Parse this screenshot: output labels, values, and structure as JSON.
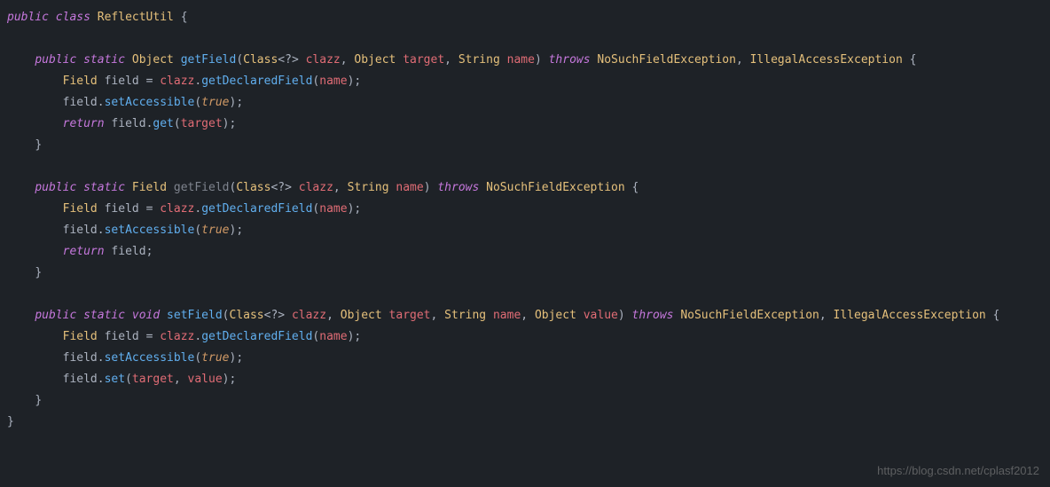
{
  "code": {
    "line1_public": "public",
    "line1_class": "class",
    "line1_classname": "ReflectUtil",
    "line1_brace": "{",
    "m1_public": "public",
    "m1_static": "static",
    "m1_rettype": "Object",
    "m1_name": "getField",
    "m1_paren_open": "(",
    "m1_type_class": "Class",
    "m1_generic": "<?>",
    "m1_param_clazz": "clazz",
    "m1_comma1": ",",
    "m1_type_object": "Object",
    "m1_param_target": "target",
    "m1_comma2": ",",
    "m1_type_string": "String",
    "m1_param_name": "name",
    "m1_paren_close": ")",
    "m1_throws": "throws",
    "m1_exc1": "NoSuchFieldException",
    "m1_comma3": ",",
    "m1_exc2": "IllegalAccessException",
    "m1_brace": "{",
    "m1b1_type": "Field",
    "m1b1_var": "field",
    "m1b1_eq": "=",
    "m1b1_clazz": "clazz",
    "m1b1_dot": ".",
    "m1b1_method": "getDeclaredField",
    "m1b1_paren_open": "(",
    "m1b1_arg": "name",
    "m1b1_paren_close": ")",
    "m1b1_semi": ";",
    "m1b2_var": "field",
    "m1b2_dot": ".",
    "m1b2_method": "setAccessible",
    "m1b2_paren_open": "(",
    "m1b2_true": "true",
    "m1b2_paren_close": ")",
    "m1b2_semi": ";",
    "m1b3_return": "return",
    "m1b3_var": "field",
    "m1b3_dot": ".",
    "m1b3_method": "get",
    "m1b3_paren_open": "(",
    "m1b3_arg": "target",
    "m1b3_paren_close": ")",
    "m1b3_semi": ";",
    "m1_close": "}",
    "m2_public": "public",
    "m2_static": "static",
    "m2_rettype": "Field",
    "m2_name": "getField",
    "m2_paren_open": "(",
    "m2_type_class": "Class",
    "m2_generic": "<?>",
    "m2_param_clazz": "clazz",
    "m2_comma1": ",",
    "m2_type_string": "String",
    "m2_param_name": "name",
    "m2_paren_close": ")",
    "m2_throws": "throws",
    "m2_exc1": "NoSuchFieldException",
    "m2_brace": "{",
    "m2b1_type": "Field",
    "m2b1_var": "field",
    "m2b1_eq": "=",
    "m2b1_clazz": "clazz",
    "m2b1_dot": ".",
    "m2b1_method": "getDeclaredField",
    "m2b1_paren_open": "(",
    "m2b1_arg": "name",
    "m2b1_paren_close": ")",
    "m2b1_semi": ";",
    "m2b2_var": "field",
    "m2b2_dot": ".",
    "m2b2_method": "setAccessible",
    "m2b2_paren_open": "(",
    "m2b2_true": "true",
    "m2b2_paren_close": ")",
    "m2b2_semi": ";",
    "m2b3_return": "return",
    "m2b3_var": "field",
    "m2b3_semi": ";",
    "m2_close": "}",
    "m3_public": "public",
    "m3_static": "static",
    "m3_rettype": "void",
    "m3_name": "setField",
    "m3_paren_open": "(",
    "m3_type_class": "Class",
    "m3_generic": "<?>",
    "m3_param_clazz": "clazz",
    "m3_comma1": ",",
    "m3_type_object": "Object",
    "m3_param_target": "target",
    "m3_comma2": ",",
    "m3_type_string": "String",
    "m3_param_name": "name",
    "m3_comma3": ",",
    "m3_type_object2": "Object",
    "m3_param_value": "value",
    "m3_paren_close": ")",
    "m3_throws": "throws",
    "m3_exc1": "NoSuchFieldException",
    "m3_comma4": ",",
    "m3_exc2": "IllegalAccessException",
    "m3_brace": "{",
    "m3b1_type": "Field",
    "m3b1_var": "field",
    "m3b1_eq": "=",
    "m3b1_clazz": "clazz",
    "m3b1_dot": ".",
    "m3b1_method": "getDeclaredField",
    "m3b1_paren_open": "(",
    "m3b1_arg": "name",
    "m3b1_paren_close": ")",
    "m3b1_semi": ";",
    "m3b2_var": "field",
    "m3b2_dot": ".",
    "m3b2_method": "setAccessible",
    "m3b2_paren_open": "(",
    "m3b2_true": "true",
    "m3b2_paren_close": ")",
    "m3b2_semi": ";",
    "m3b3_var": "field",
    "m3b3_dot": ".",
    "m3b3_method": "set",
    "m3b3_paren_open": "(",
    "m3b3_arg1": "target",
    "m3b3_comma": ",",
    "m3b3_arg2": "value",
    "m3b3_paren_close": ")",
    "m3b3_semi": ";",
    "m3_close": "}",
    "class_close": "}"
  },
  "watermark": "https://blog.csdn.net/cplasf2012"
}
